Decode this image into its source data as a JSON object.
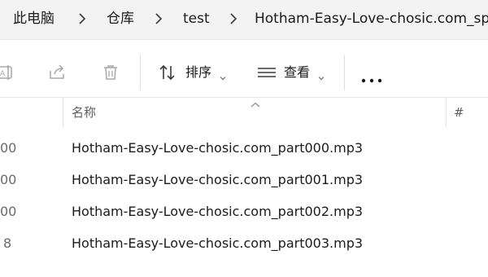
{
  "breadcrumb": {
    "items": [
      "此电脑",
      "仓库",
      "test",
      "Hotham-Easy-Love-chosic.com_sp"
    ]
  },
  "toolbar": {
    "sort_label": "排序",
    "view_label": "查看",
    "more_icon": "more-horizontal-icon"
  },
  "columns": {
    "name": "名称",
    "number": "#"
  },
  "files": [
    {
      "left_fragment": "00",
      "name": "Hotham-Easy-Love-chosic.com_part000.mp3"
    },
    {
      "left_fragment": "00",
      "name": "Hotham-Easy-Love-chosic.com_part001.mp3"
    },
    {
      "left_fragment": "00",
      "name": "Hotham-Easy-Love-chosic.com_part002.mp3"
    },
    {
      "left_fragment": "8",
      "name": "Hotham-Easy-Love-chosic.com_part003.mp3"
    }
  ],
  "colors": {
    "breadcrumb_bg": "#f3f3f3",
    "text": "#1b1b1b",
    "muted_icon": "#a7a7a7",
    "icon": "#3a3a3a"
  }
}
